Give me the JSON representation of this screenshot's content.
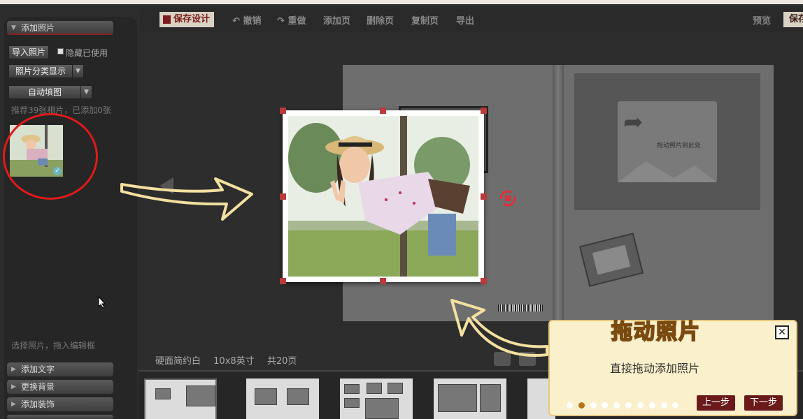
{
  "left_panel": {
    "add_photos": "添加照片",
    "import_button": "导入照片",
    "hide_used": "隐藏已使用",
    "category_button": "照片分类显示",
    "auto_fill_button": "自动填图",
    "recommend_text": "推荐39张相片，已添加0张",
    "drag_hint": "选择照片，拖入编辑框",
    "add_text": "添加文字",
    "change_bg": "更换背景",
    "add_decoration": "添加装饰"
  },
  "toolbar": {
    "save_design": "保存设计",
    "undo": "撤销",
    "redo": "重做",
    "add_page": "添加页",
    "delete_page": "删除页",
    "copy_page": "复制页",
    "export": "导出",
    "preview": "预览",
    "save": "保存"
  },
  "canvas": {
    "placeholder_text": "拖动照片到此处"
  },
  "footer": {
    "style": "硬面简约白",
    "size": "10x8英寸",
    "pages": "共20页"
  },
  "tutorial": {
    "title": "拖动照片",
    "description": "直接拖动添加照片",
    "prev": "上一步",
    "next": "下一步",
    "total_steps": 10,
    "current_step": 2
  },
  "colors": {
    "accent_red": "#e21a1a",
    "handle": "#b83a3a",
    "button_dark_red": "#6a1a1a",
    "popup_bg": "#fbf0cc"
  }
}
